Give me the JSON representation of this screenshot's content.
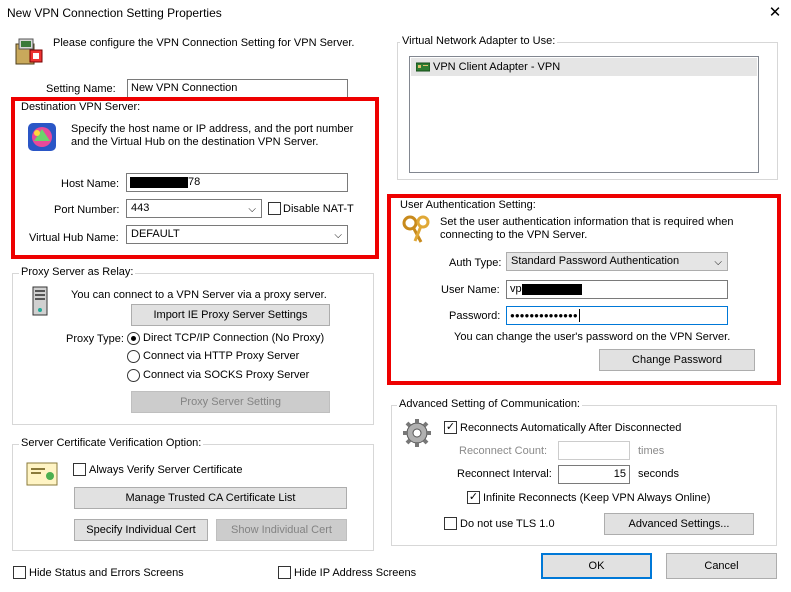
{
  "window": {
    "title": "New VPN Connection Setting Properties",
    "close_glyph": "✕"
  },
  "intro_text": "Please configure the VPN Connection Setting for VPN Server.",
  "setting_name": {
    "label": "Setting Name:",
    "value": "New VPN Connection"
  },
  "destination": {
    "group_title": "Destination VPN Server:",
    "desc_line1": "Specify the host name or IP address, and the port number",
    "desc_line2": "and the Virtual Hub on the destination VPN Server.",
    "host_label": "Host Name:",
    "host_value_suffix": "78",
    "port_label": "Port Number:",
    "port_value": "443",
    "disable_nat_label": "Disable NAT-T",
    "hub_label": "Virtual Hub Name:",
    "hub_value": "DEFAULT"
  },
  "proxy": {
    "group_title": "Proxy Server as Relay:",
    "desc": "You can connect to a VPN Server via a proxy server.",
    "import_button": "Import IE Proxy Server Settings",
    "type_label": "Proxy Type:",
    "options": [
      "Direct TCP/IP Connection (No Proxy)",
      "Connect via HTTP Proxy Server",
      "Connect via SOCKS Proxy Server"
    ],
    "selected_option": "Direct TCP/IP Connection (No Proxy)",
    "setting_button": "Proxy Server Setting"
  },
  "cert": {
    "group_title": "Server Certificate Verification Option:",
    "always_verify_label": "Always Verify Server Certificate",
    "manage_ca_button": "Manage Trusted CA Certificate List",
    "specify_cert_button": "Specify Individual Cert",
    "show_cert_button": "Show Individual Cert"
  },
  "bottom_left": {
    "hide_status_label": "Hide Status and Errors Screens",
    "hide_ip_label": "Hide IP Address Screens"
  },
  "adapter": {
    "group_title": "Virtual Network Adapter to Use:",
    "items": [
      "VPN Client Adapter - VPN"
    ]
  },
  "auth": {
    "group_title": "User Authentication Setting:",
    "desc_line1": "Set the user authentication information that is required when",
    "desc_line2": "connecting to the VPN Server.",
    "type_label": "Auth Type:",
    "type_value": "Standard Password Authentication",
    "user_label": "User Name:",
    "user_value_prefix": "vp",
    "password_label": "Password:",
    "password_value": "●●●●●●●●●●●●●●",
    "change_hint": "You can change the user's password on the VPN Server.",
    "change_button": "Change Password"
  },
  "advanced": {
    "group_title": "Advanced Setting of Communication:",
    "reconnect_auto_label": "Reconnects Automatically After Disconnected",
    "reconnect_count_label": "Reconnect Count:",
    "reconnect_count_unit": "times",
    "reconnect_interval_label": "Reconnect Interval:",
    "reconnect_interval_value": "15",
    "reconnect_interval_unit": "seconds",
    "infinite_label": "Infinite Reconnects (Keep VPN Always Online)",
    "no_tls_label": "Do not use TLS 1.0",
    "advanced_button": "Advanced Settings..."
  },
  "footer": {
    "ok_button": "OK",
    "cancel_button": "Cancel"
  },
  "check_glyph": "✓",
  "dropdown_glyph": "⌵",
  "colors": {
    "highlight_border": "#ee0000",
    "focus_blue": "#0078d7"
  }
}
